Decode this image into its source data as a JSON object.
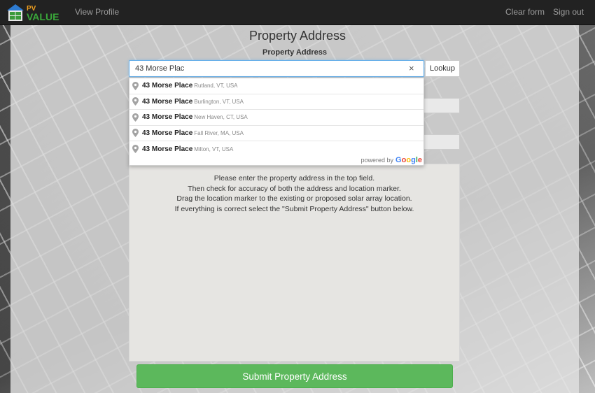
{
  "navbar": {
    "logo_text_top": "PV",
    "logo_text_bottom": "VALUE",
    "view_profile": "View Profile",
    "clear_form": "Clear form",
    "sign_out": "Sign out"
  },
  "page": {
    "title": "Property Address",
    "field_label": "Property Address"
  },
  "search": {
    "value": "43 Morse Plac",
    "clear_icon": "×",
    "lookup_label": "Lookup"
  },
  "autocomplete": {
    "items": [
      {
        "main": "43 Morse Place",
        "sub": "Rutland, VT, USA"
      },
      {
        "main": "43 Morse Place",
        "sub": "Burlington, VT, USA"
      },
      {
        "main": "43 Morse Place",
        "sub": "New Haven, CT, USA"
      },
      {
        "main": "43 Morse Place",
        "sub": "Fall River, MA, USA"
      },
      {
        "main": "43 Morse Place",
        "sub": "Milton, VT, USA"
      }
    ],
    "powered_by": "powered by",
    "google": {
      "g1": "G",
      "g2": "o",
      "g3": "o",
      "g4": "g",
      "g5": "l",
      "g6": "e"
    },
    "icon": "map-pin-icon"
  },
  "instructions": {
    "line1": "Please enter the property address in the top field.",
    "line2": "Then check for accuracy of both the address and location marker.",
    "line3": "Drag the location marker to the existing or proposed solar array location.",
    "line4": "If everything is correct select the \"Submit Property Address\" button below."
  },
  "submit_label": "Submit Property Address",
  "colors": {
    "navbar": "#222222",
    "submit": "#5cb85c",
    "input_focus": "#66afe9"
  }
}
